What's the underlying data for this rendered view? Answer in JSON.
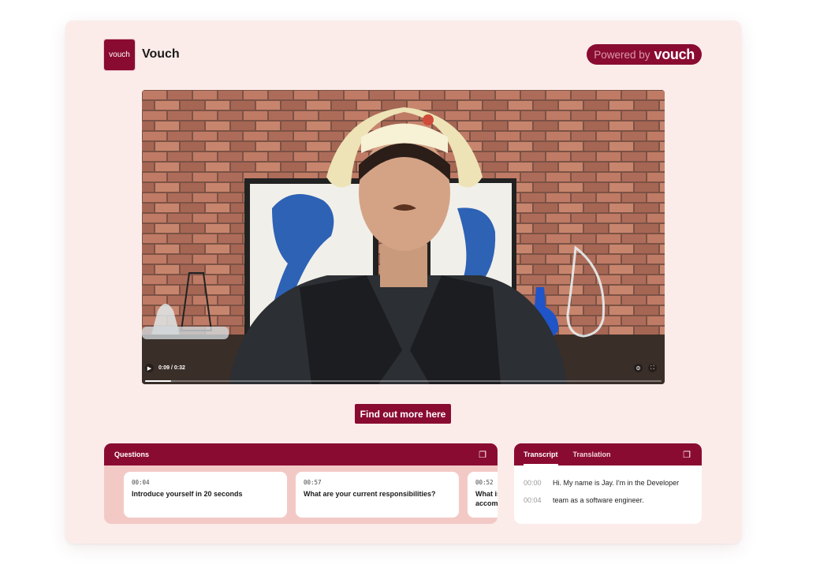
{
  "brand": {
    "logo_text": "vouch",
    "name": "Vouch",
    "accent": "#8a0b32",
    "background": "#fbecea"
  },
  "powered_by": {
    "label": "Powered by",
    "word": "vouch"
  },
  "video": {
    "time": "0:09 / 0:32",
    "progress": 0.05,
    "icons": [
      "play-icon",
      "settings-icon",
      "fullscreen-icon"
    ]
  },
  "cta": {
    "label": "Find out more here"
  },
  "questions": {
    "title": "Questions",
    "copy_icon": "copy-icon",
    "items": [
      {
        "time": "00:04",
        "text": "Introduce yourself in 20 seconds"
      },
      {
        "time": "00:57",
        "text": "What are your current responsibilities?"
      },
      {
        "time": "00:52",
        "text": "What is one thing you'd like to accomplish?"
      }
    ]
  },
  "transcript": {
    "tabs": [
      "Transcript",
      "Translation"
    ],
    "lines": [
      {
        "time": "00:00",
        "text": "Hi. My name is Jay. I'm in the Developer"
      },
      {
        "time": "00:04",
        "text": "team as a software engineer."
      }
    ]
  }
}
